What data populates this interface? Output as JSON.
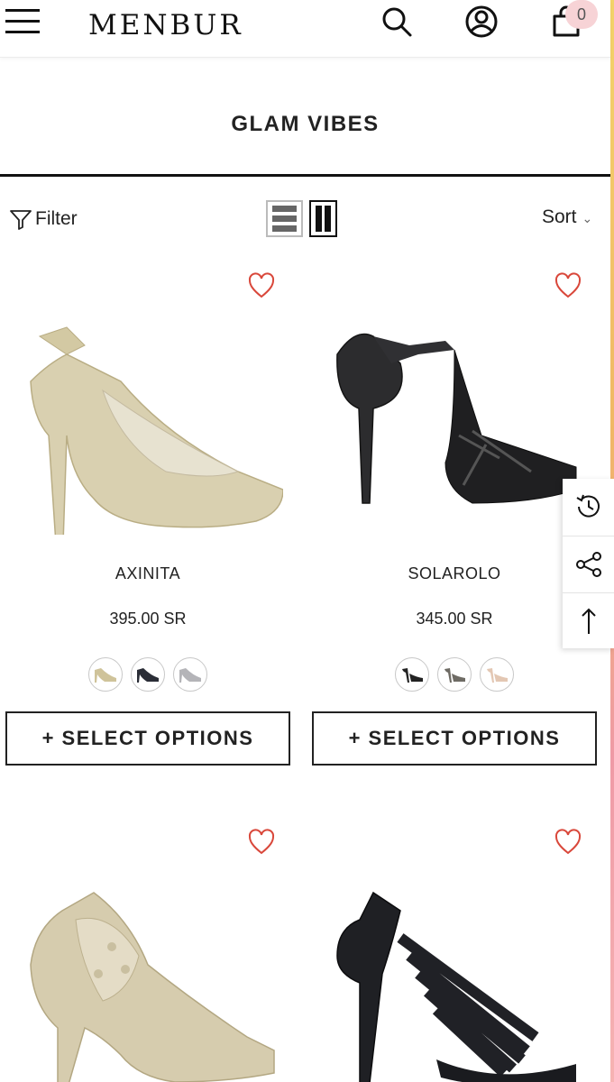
{
  "header": {
    "logo": "MENBUR",
    "cart_count": "0",
    "icons": [
      "menu-icon",
      "search-icon",
      "account-icon",
      "cart-icon"
    ]
  },
  "collection": {
    "title": "GLAM VIBES"
  },
  "toolbar": {
    "filter_label": "Filter",
    "sort_label": "Sort"
  },
  "products": [
    {
      "name": "AXINITA",
      "price": "395.00 SR",
      "button": "+ SELECT OPTIONS",
      "color": "gold",
      "swatches": [
        "gold",
        "black",
        "silver"
      ]
    },
    {
      "name": "SOLAROLO",
      "price": "345.00 SR",
      "button": "+ SELECT OPTIONS",
      "color": "black",
      "swatches": [
        "black",
        "grey",
        "nude"
      ]
    },
    {
      "name": "",
      "price": "",
      "button": "",
      "color": "gold",
      "swatches": []
    },
    {
      "name": "",
      "price": "",
      "button": "",
      "color": "black",
      "swatches": []
    }
  ],
  "colors": {
    "wishlist": "#d9473a",
    "accent_strip": "#f3d36a",
    "badge_bg": "#f7d3d6"
  },
  "side_tools": [
    "recently-viewed-icon",
    "share-icon",
    "back-to-top-icon"
  ]
}
